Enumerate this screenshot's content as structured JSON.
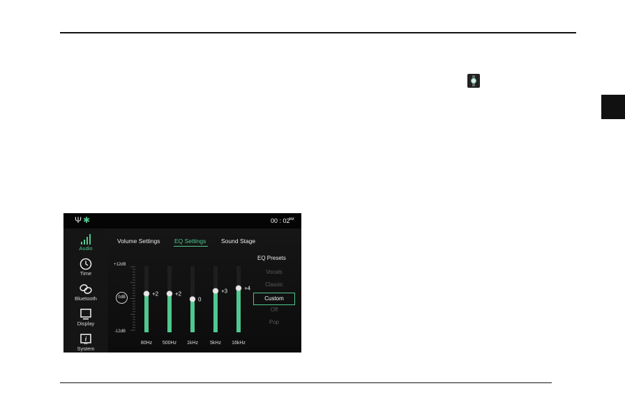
{
  "status": {
    "usb_glyph": "Ψ",
    "bt_glyph": "✱",
    "clock": "00 : 02",
    "ampm": "AM"
  },
  "sidebar": {
    "items": [
      {
        "label": "Audio",
        "icon": "audio-bars-icon",
        "active": true
      },
      {
        "label": "Time",
        "icon": "clock-icon",
        "active": false
      },
      {
        "label": "Bluetooth",
        "icon": "link-icon",
        "active": false
      },
      {
        "label": "Display",
        "icon": "monitor-icon",
        "active": false
      },
      {
        "label": "System",
        "icon": "info-icon",
        "active": false
      }
    ]
  },
  "tabs": [
    {
      "label": "Volume Settings",
      "active": false
    },
    {
      "label": "EQ Settings",
      "active": true
    },
    {
      "label": "Sound Stage",
      "active": false
    }
  ],
  "eq": {
    "max_label": "+12dB",
    "min_label": "-12dB",
    "zero_button": "0dB",
    "range": [
      -12,
      12
    ],
    "bands": [
      {
        "freq": "80Hz",
        "value": 2,
        "value_label": "+2"
      },
      {
        "freq": "500Hz",
        "value": 2,
        "value_label": "+2"
      },
      {
        "freq": "1kHz",
        "value": 0,
        "value_label": "0"
      },
      {
        "freq": "5kHz",
        "value": 3,
        "value_label": "+3"
      },
      {
        "freq": "16kHz",
        "value": 4,
        "value_label": "+4"
      }
    ]
  },
  "presets": {
    "title": "EQ Presets",
    "items": [
      "Vocals",
      "Classic",
      "Custom",
      "Off",
      "Pop"
    ],
    "selected": "Custom"
  },
  "colors": {
    "accent": "#4fc88f",
    "screen_bg": "#0b0b0b",
    "sidebar_bg": "#151515"
  }
}
